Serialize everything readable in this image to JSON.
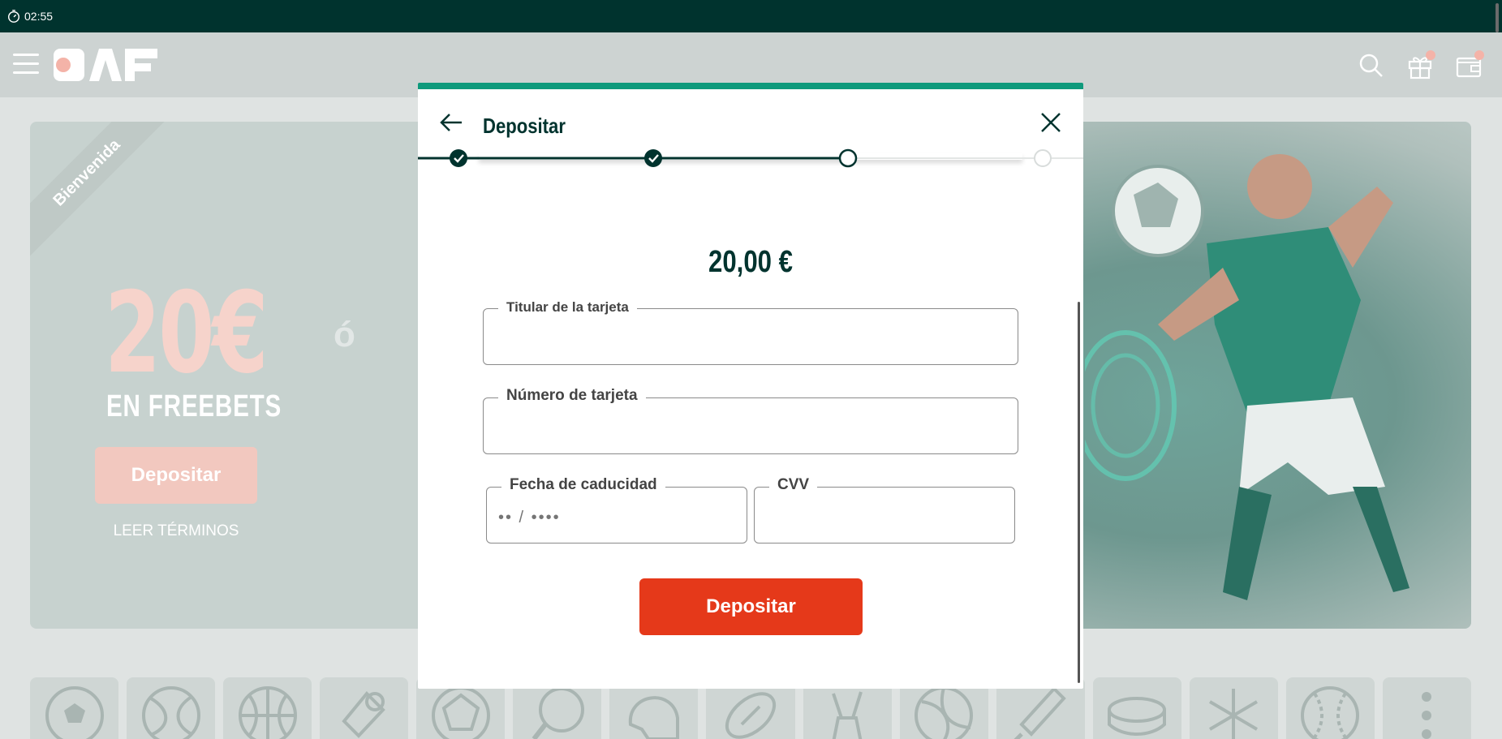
{
  "statusbar": {
    "time": "02:55"
  },
  "header": {
    "logo_text": "PAF"
  },
  "hero": {
    "ribbon": "Bienvenida",
    "amount": "20€",
    "subtitle": "EN FREEBETS",
    "or": "ó",
    "button": "Depositar",
    "terms": "LEER TÉRMINOS"
  },
  "modal": {
    "title": "Depositar",
    "amount": "20,00 €",
    "fields": {
      "holder": {
        "label": "Titular de la tarjeta",
        "value": ""
      },
      "number": {
        "label": "Número de tarjeta",
        "value": ""
      },
      "expiry": {
        "label": "Fecha de caducidad",
        "placeholder": "•• / ••••"
      },
      "cvv": {
        "label": "CVV",
        "value": ""
      }
    },
    "submit": "Depositar",
    "steps": [
      "complete",
      "complete",
      "current",
      "pending"
    ]
  },
  "sports": [
    "football-icon",
    "tennis-icon",
    "basketball-icon",
    "esports-icon",
    "handball-icon",
    "table-tennis-icon",
    "american-football-helmet-icon",
    "rugby-icon",
    "golf-icon",
    "volleyball-icon",
    "cricket-icon",
    "ice-hockey-icon",
    "winter-sports-icon",
    "baseball-icon",
    "more-icon"
  ],
  "colors": {
    "brand_dark": "#00332e",
    "accent_green": "#0f9a7c",
    "cta_red": "#e5391a"
  }
}
